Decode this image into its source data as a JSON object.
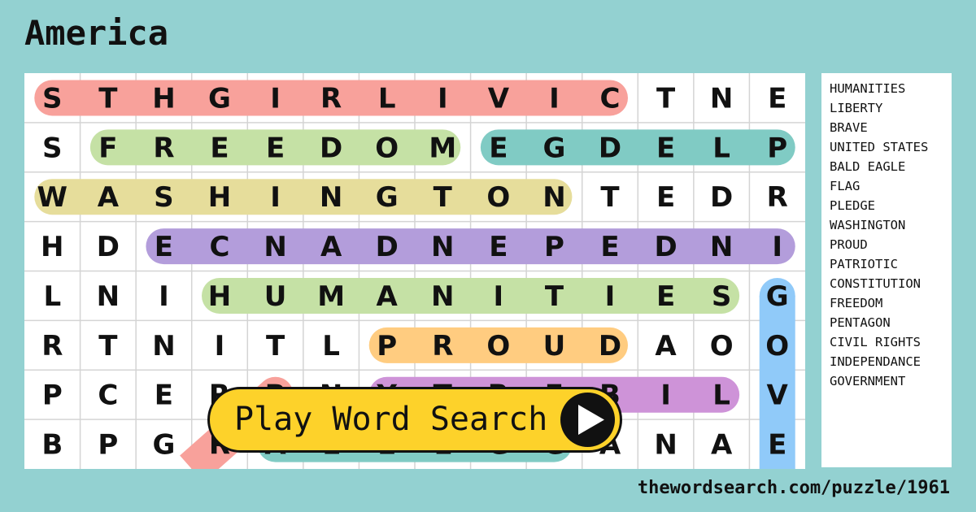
{
  "title": "America",
  "grid": [
    [
      "S",
      "T",
      "H",
      "G",
      "I",
      "R",
      "L",
      "I",
      "V",
      "I",
      "C",
      "T",
      "N",
      "E"
    ],
    [
      "S",
      "F",
      "R",
      "E",
      "E",
      "D",
      "O",
      "M",
      "E",
      "G",
      "D",
      "E",
      "L",
      "P"
    ],
    [
      "W",
      "A",
      "S",
      "H",
      "I",
      "N",
      "G",
      "T",
      "O",
      "N",
      "T",
      "E",
      "D",
      "R"
    ],
    [
      "H",
      "D",
      "E",
      "C",
      "N",
      "A",
      "D",
      "N",
      "E",
      "P",
      "E",
      "D",
      "N",
      "I"
    ],
    [
      "L",
      "N",
      "I",
      "H",
      "U",
      "M",
      "A",
      "N",
      "I",
      "T",
      "I",
      "E",
      "S",
      "G"
    ],
    [
      "R",
      "T",
      "N",
      "I",
      "T",
      "L",
      "P",
      "R",
      "O",
      "U",
      "D",
      "A",
      "O",
      "O"
    ],
    [
      "P",
      "C",
      "E",
      "R",
      "B",
      "N",
      "Y",
      "T",
      "R",
      "E",
      "B",
      "I",
      "L",
      "V"
    ],
    [
      "B",
      "P",
      "G",
      "R",
      "A",
      "L",
      "E",
      "L",
      "G",
      "G",
      "A",
      "N",
      "A",
      "E"
    ]
  ],
  "highlights": [
    {
      "word": "CIVIL RIGHTS",
      "from": [
        0,
        10
      ],
      "to": [
        0,
        0
      ],
      "color": "#f8a19b"
    },
    {
      "word": "FREEDOM",
      "from": [
        1,
        1
      ],
      "to": [
        1,
        7
      ],
      "color": "#c5e1a5"
    },
    {
      "word": "PLEDGE",
      "from": [
        1,
        13
      ],
      "to": [
        1,
        8
      ],
      "color": "#80cbc4"
    },
    {
      "word": "WASHINGTON",
      "from": [
        2,
        0
      ],
      "to": [
        2,
        9
      ],
      "color": "#e6dd9b"
    },
    {
      "word": "INDEPENDANCE",
      "from": [
        3,
        13
      ],
      "to": [
        3,
        2
      ],
      "color": "#b39ddb"
    },
    {
      "word": "HUMANITIES",
      "from": [
        4,
        3
      ],
      "to": [
        4,
        12
      ],
      "color": "#c5e1a5"
    },
    {
      "word": "PROUD",
      "from": [
        5,
        6
      ],
      "to": [
        5,
        10
      ],
      "color": "#ffcc80"
    },
    {
      "word": "LIBERTY",
      "from": [
        6,
        12
      ],
      "to": [
        6,
        6
      ],
      "color": "#ce93d8"
    },
    {
      "word": "GOVERNMENT",
      "from": [
        4,
        13
      ],
      "to": [
        9,
        13
      ],
      "color": "#90caf9"
    },
    {
      "word": "FLAG",
      "from": [
        6,
        4
      ],
      "to": [
        9,
        1
      ],
      "color": "#f8a19b"
    },
    {
      "word": "",
      "from": [
        7,
        4
      ],
      "to": [
        7,
        9
      ],
      "color": "#80cbc4"
    }
  ],
  "words": [
    "HUMANITIES",
    "LIBERTY",
    "BRAVE",
    "UNITED STATES",
    "BALD EAGLE",
    "FLAG",
    "PLEDGE",
    "WASHINGTON",
    "PROUD",
    "PATRIOTIC",
    "CONSTITUTION",
    "FREEDOM",
    "PENTAGON",
    "CIVIL RIGHTS",
    "INDEPENDANCE",
    "GOVERNMENT"
  ],
  "play_button": {
    "label": "Play Word Search",
    "icon": "play-icon"
  },
  "url": "thewordsearch.com/puzzle/1961",
  "colors": {
    "background": "#93d1d1",
    "button": "#fdd22a"
  }
}
